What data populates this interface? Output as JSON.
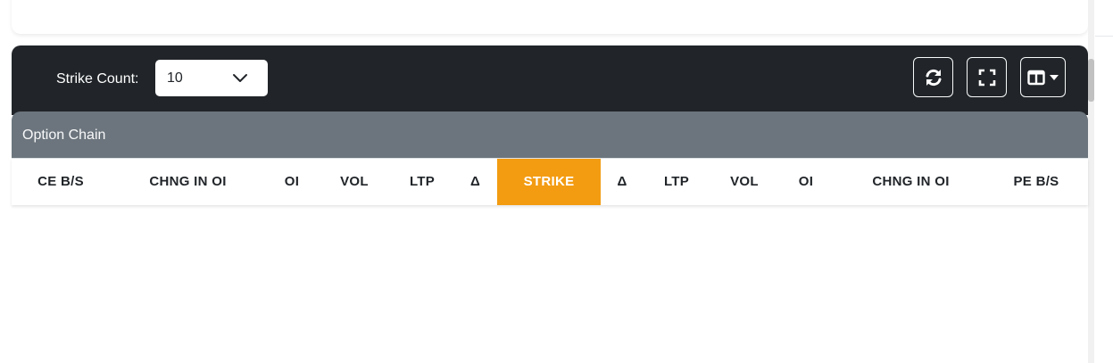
{
  "toolbar": {
    "strike_count_label": "Strike Count:",
    "strike_count_value": "10",
    "buttons": {
      "refresh_icon": "refresh-icon",
      "fullscreen_icon": "fullscreen-icon",
      "columns_icon": "columns-icon"
    },
    "background_color": "#212529"
  },
  "option_chain": {
    "title": "Option Chain",
    "header_color": "#6c757d",
    "strike_highlight_color": "#f39c12",
    "columns": [
      "CE B/S",
      "CHNG IN OI",
      "OI",
      "VOL",
      "LTP",
      "Δ",
      "STRIKE",
      "Δ",
      "LTP",
      "VOL",
      "OI",
      "CHNG IN OI",
      "PE B/S"
    ]
  }
}
